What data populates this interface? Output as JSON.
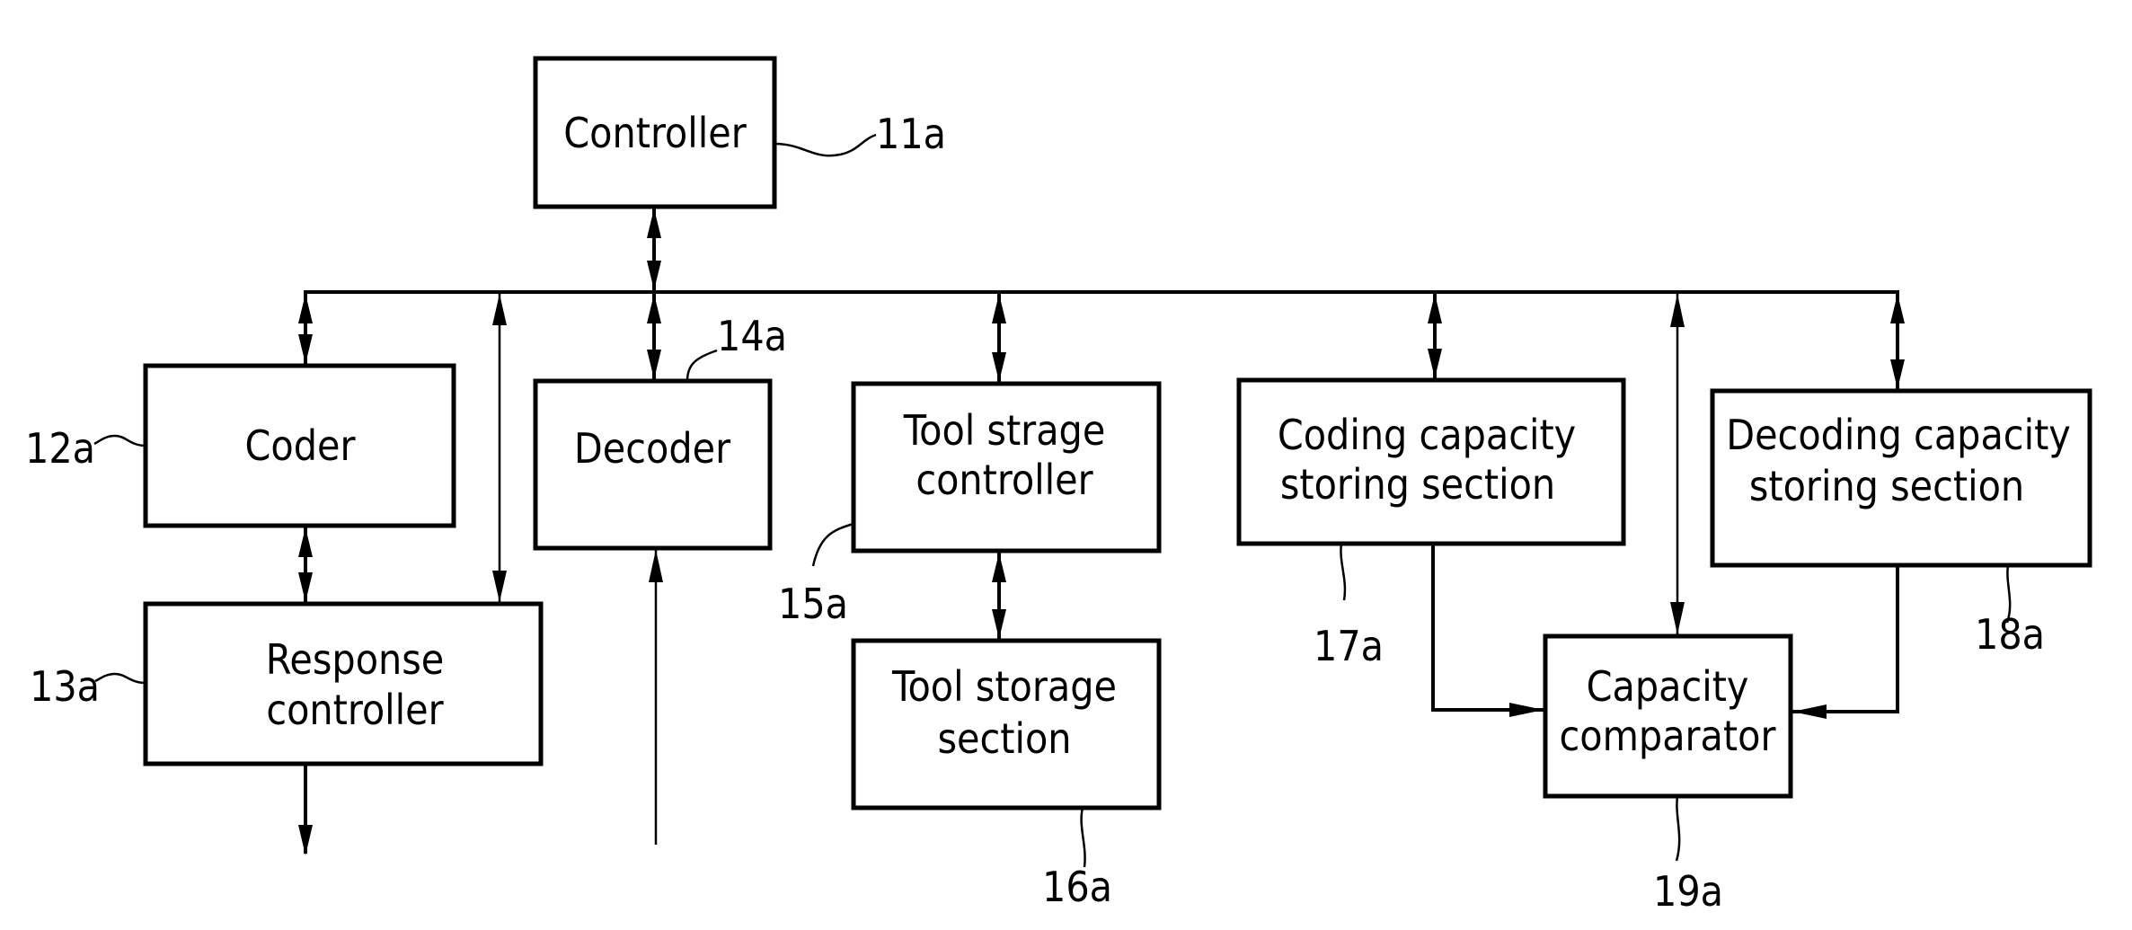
{
  "figure": {
    "blocks": [
      {
        "id": "controller",
        "lines": [
          "Controller"
        ],
        "ref": "11a"
      },
      {
        "id": "coder",
        "lines": [
          "Coder"
        ],
        "ref": "12a"
      },
      {
        "id": "response-controller",
        "lines": [
          "Response",
          "controller"
        ],
        "ref": "13a"
      },
      {
        "id": "decoder",
        "lines": [
          "Decoder"
        ],
        "ref": "14a"
      },
      {
        "id": "tool-strage-controller",
        "lines": [
          "Tool strage",
          "controller"
        ],
        "ref": "15a"
      },
      {
        "id": "tool-storage-section",
        "lines": [
          "Tool storage",
          "section"
        ],
        "ref": "16a"
      },
      {
        "id": "coding-capacity-storing-section",
        "lines": [
          "Coding capacity",
          "storing section"
        ],
        "ref": "17a"
      },
      {
        "id": "decoding-capacity-storing-section",
        "lines": [
          "Decoding capacity",
          "storing section"
        ],
        "ref": "18a"
      },
      {
        "id": "capacity-comparator",
        "lines": [
          "Capacity",
          "comparator"
        ],
        "ref": "19a"
      }
    ]
  }
}
